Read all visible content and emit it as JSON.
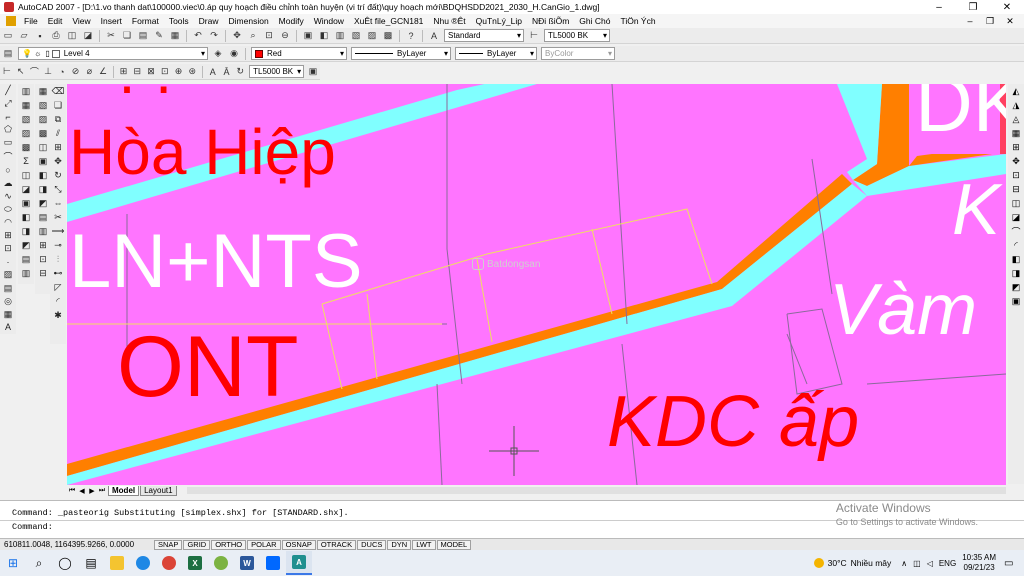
{
  "window": {
    "title": "AutoCAD 2007 - [D:\\1.vo thanh dat\\100000.viec\\0.áp quy hoạch điều chỉnh toàn huyện (vi trí đất)\\quy hoạch mới\\BDQHSDD2021_2030_H.CanGio_1.dwg]",
    "controls": [
      "–",
      "❐",
      "✕"
    ]
  },
  "menu": {
    "items": [
      "File",
      "Edit",
      "View",
      "Insert",
      "Format",
      "Tools",
      "Draw",
      "Dimension",
      "Modify",
      "Window",
      "XuÊt file_GCN181",
      "Nhu ®Êt",
      "QuTnLý_Lip",
      "NÐi ßiÕm",
      "Ghi Chó",
      "TiÖn Ých"
    ],
    "mdi_controls": [
      "–",
      "❐",
      "✕"
    ]
  },
  "toolbar": {
    "text_style": "Standard",
    "dim_style": "TL5000 BK",
    "layer": "Level 4",
    "color": "Red",
    "linetype": "ByLayer",
    "lineweight": "ByLayer",
    "plotstyle": "ByColor",
    "dim_style_2": "TL5000 BK"
  },
  "drawing": {
    "labels": {
      "hoa_hiep": "Hòa Hiệp",
      "ln_nts": "LN+NTS",
      "ont": "ONT",
      "kdc": "KDC ấp",
      "vam": "Vàm",
      "dk": "DK",
      "k": "K"
    },
    "watermark": "Batdongsan"
  },
  "tabs": {
    "nav": [
      "⏮",
      "◀",
      "▶",
      "⏭"
    ],
    "items": [
      "Model",
      "Layout1"
    ]
  },
  "command": {
    "history": "Command: _pasteorig Substituting [simplex.shx] for [STANDARD.shx].",
    "prompt": "Command:"
  },
  "activate_windows": {
    "line1": "Activate Windows",
    "line2": "Go to Settings to activate Windows."
  },
  "status": {
    "coords": "610811.0048, 1164395.9266, 0.0000",
    "buttons": [
      "SNAP",
      "GRID",
      "ORTHO",
      "POLAR",
      "OSNAP",
      "OTRACK",
      "DUCS",
      "DYN",
      "LWT",
      "MODEL"
    ]
  },
  "taskbar": {
    "weather_temp": "30°C",
    "weather_desc": "Nhiều mây",
    "lang": "ENG",
    "time": "10:35 AM",
    "date": "09/21/23"
  },
  "colors": {
    "drawing_bg": "#ff75ff",
    "road_cyan": "#80ffff",
    "road_orange": "#ff7f00",
    "label_red": "#ff0000",
    "label_white": "#ffffff"
  }
}
